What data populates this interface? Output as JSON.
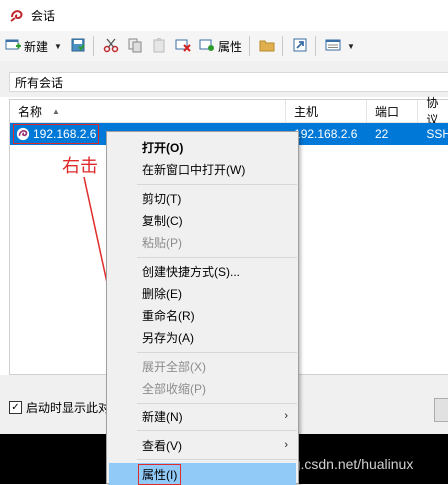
{
  "window": {
    "title": "会话"
  },
  "toolbar": {
    "new_label": "新建",
    "properties_label": "属性"
  },
  "section": {
    "label": "所有会话"
  },
  "table": {
    "headers": {
      "name": "名称",
      "host": "主机",
      "port": "端口",
      "protocol": "协议"
    },
    "rows": [
      {
        "name": "192.168.2.6",
        "host": "192.168.2.6",
        "port": "22",
        "protocol": "SSH"
      }
    ]
  },
  "bottom": {
    "startup_label": "启动时显示此对"
  },
  "annotation": {
    "text": "右击"
  },
  "context_menu": {
    "items": [
      {
        "label": "打开(O)"
      },
      {
        "label": "在新窗口中打开(W)"
      },
      {
        "label": "剪切(T)"
      },
      {
        "label": "复制(C)"
      },
      {
        "label": "粘贴(P)"
      },
      {
        "label": "创建快捷方式(S)..."
      },
      {
        "label": "删除(E)"
      },
      {
        "label": "重命名(R)"
      },
      {
        "label": "另存为(A)"
      },
      {
        "label": "展开全部(X)"
      },
      {
        "label": "全部收缩(P)"
      },
      {
        "label": "新建(N)"
      },
      {
        "label": "查看(V)"
      },
      {
        "label": "属性(I)"
      }
    ]
  },
  "watermark": "https://blog.csdn.net/hualinux",
  "colors": {
    "selection": "#0078d7",
    "annotation": "#e02b2b",
    "menu_highlight": "#91c9f7"
  }
}
